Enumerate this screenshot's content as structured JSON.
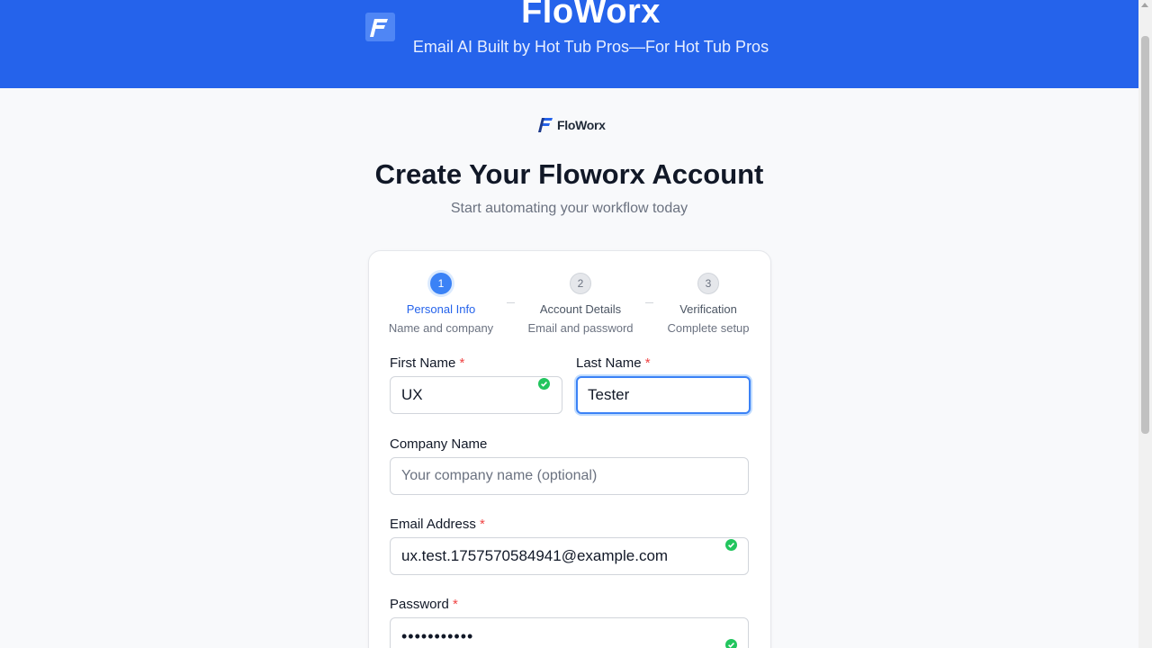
{
  "header": {
    "title": "FloWorx",
    "subtitle": "Email AI Built by Hot Tub Pros—For Hot Tub Pros",
    "logo_icon": "floworx-logo-icon"
  },
  "brand": {
    "name": "FloWorx"
  },
  "page": {
    "title": "Create Your Floworx Account",
    "subtitle": "Start automating your workflow today"
  },
  "steps": [
    {
      "number": "1",
      "label": "Personal Info",
      "description": "Name and company",
      "active": true
    },
    {
      "number": "2",
      "label": "Account Details",
      "description": "Email and password",
      "active": false
    },
    {
      "number": "3",
      "label": "Verification",
      "description": "Complete setup",
      "active": false
    }
  ],
  "form": {
    "first_name": {
      "label": "First Name",
      "required_mark": "*",
      "value": "UX",
      "valid": true
    },
    "last_name": {
      "label": "Last Name",
      "required_mark": "*",
      "value": "Tester"
    },
    "company": {
      "label": "Company Name",
      "placeholder": "Your company name (optional)",
      "value": ""
    },
    "email": {
      "label": "Email Address",
      "required_mark": "*",
      "value": "ux.test.1757570584941@example.com",
      "valid": true
    },
    "password": {
      "label": "Password",
      "required_mark": "*",
      "value": "•••••••••••",
      "valid": true
    }
  },
  "colors": {
    "primary": "#2563eb",
    "success": "#22c55e",
    "required": "#ef4444"
  }
}
